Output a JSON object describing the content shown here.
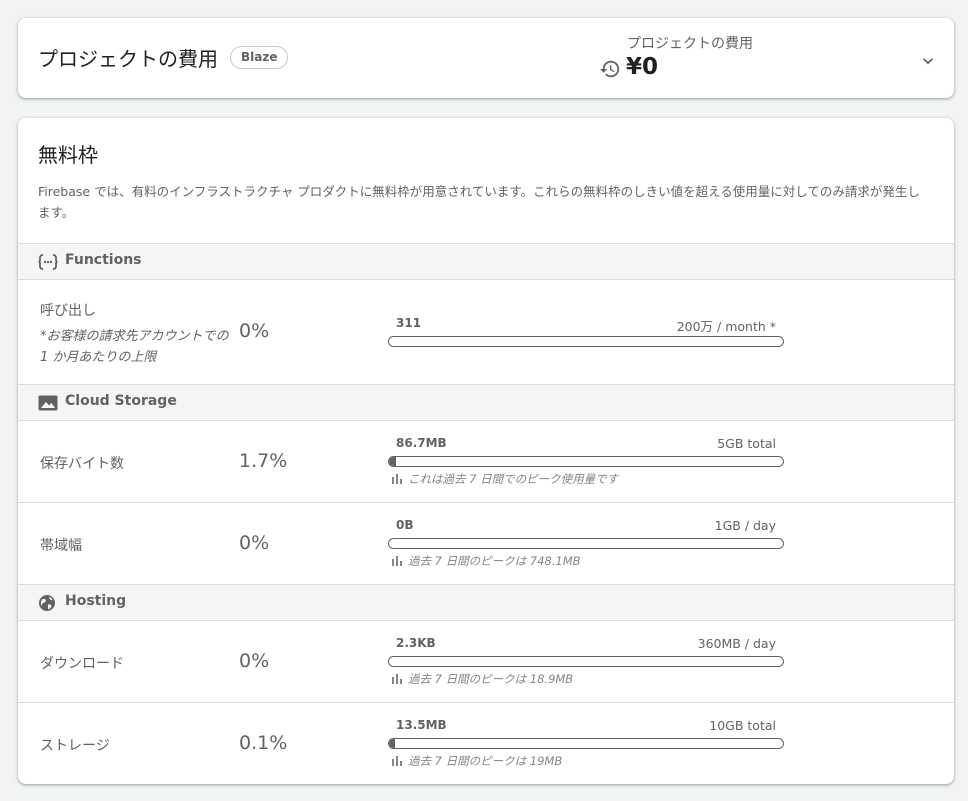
{
  "header": {
    "title": "プロジェクトの費用",
    "plan_badge": "Blaze",
    "cost_label": "プロジェクトの費用",
    "cost_value": "¥0",
    "icons": {
      "history": "history-icon",
      "expand": "chevron-down-icon"
    }
  },
  "free_tier": {
    "title": "無料枠",
    "description": "Firebase では、有料のインフラストラクチャ プロダクトに無料枠が用意されています。これらの無料枠のしきい値を超える使用量に対してのみ請求が発生します。",
    "sections": [
      {
        "title": "Functions",
        "icon": "functions-icon",
        "rows": [
          {
            "label": "呼び出し",
            "note": "*お客様の請求先アカウントでの 1 か月あたりの上限",
            "percent": "0%",
            "used": "311",
            "limit": "200万 / month *",
            "fill": 0.0
          }
        ]
      },
      {
        "title": "Cloud Storage",
        "icon": "image-icon",
        "rows": [
          {
            "label": "保存バイト数",
            "percent": "1.7%",
            "used": "86.7MB",
            "limit": "5GB total",
            "fill": 0.017,
            "peak": "これは過去 7 日間でのピーク使用量です"
          },
          {
            "label": "帯域幅",
            "percent": "0%",
            "used": "0B",
            "limit": "1GB / day",
            "fill": 0.0,
            "peak": "過去 7 日間のピークは 748.1MB"
          }
        ]
      },
      {
        "title": "Hosting",
        "icon": "globe-icon",
        "rows": [
          {
            "label": "ダウンロード",
            "percent": "0%",
            "used": "2.3KB",
            "limit": "360MB / day",
            "fill": 0.0,
            "peak": "過去 7 日間のピークは 18.9MB"
          },
          {
            "label": "ストレージ",
            "percent": "0.1%",
            "used": "13.5MB",
            "limit": "10GB total",
            "fill": 0.001,
            "peak": "過去 7 日間のピークは 19MB"
          }
        ]
      }
    ]
  },
  "colors": {
    "background": "#f1f3f4",
    "card": "#ffffff",
    "section_header": "#f5f5f5",
    "text_primary": "#202124",
    "text_secondary": "#5f6368",
    "bar": "#5f6368"
  }
}
